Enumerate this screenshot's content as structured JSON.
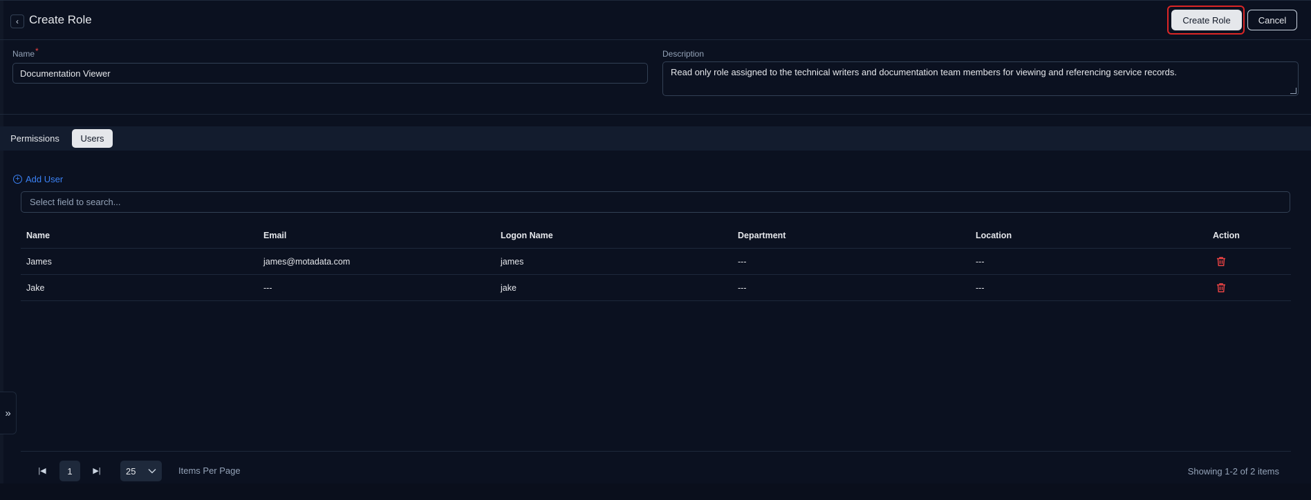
{
  "header": {
    "title": "Create Role",
    "create_label": "Create Role",
    "cancel_label": "Cancel"
  },
  "form": {
    "name_label": "Name",
    "required_mark": "*",
    "name_value": "Documentation Viewer",
    "description_label": "Description",
    "description_value": "Read only role assigned to the technical writers and documentation team members for viewing and referencing service records."
  },
  "tabs": [
    {
      "label": "Permissions",
      "active": false
    },
    {
      "label": "Users",
      "active": true
    }
  ],
  "users": {
    "add_label": "Add User",
    "search_placeholder": "Select field to search...",
    "columns": [
      "Name",
      "Email",
      "Logon Name",
      "Department",
      "Location",
      "Action"
    ],
    "rows": [
      [
        "James",
        "james@motadata.com",
        "james",
        "---",
        "---"
      ],
      [
        "Jake",
        "---",
        "jake",
        "---",
        "---"
      ]
    ]
  },
  "pagination": {
    "current_page": "1",
    "per_page": "25",
    "items_per_page_label": "Items Per Page",
    "showing": "Showing 1-2 of 2 items"
  },
  "icons": {
    "back": "chevron-left-icon",
    "add": "plus-circle-icon",
    "delete": "trash-icon",
    "expand": "double-chevron-right-icon"
  },
  "colors": {
    "background": "#0b1120",
    "accent": "#3b82f6",
    "danger": "#ef4444",
    "highlight": "#dc2626"
  }
}
